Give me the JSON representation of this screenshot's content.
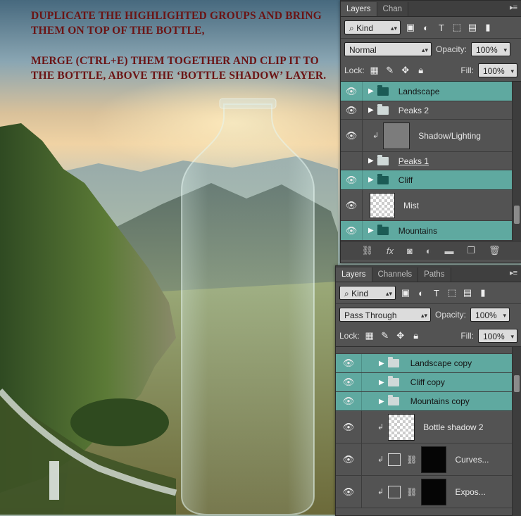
{
  "instructions": {
    "line1": "Duplicate the highlighted groups and bring them on top of the bottle,",
    "line2": "Merge (Ctrl+E) them together and clip it to the bottle, above the ‘bottle shadow’ layer."
  },
  "panel_top": {
    "tabs": [
      "Layers",
      "Chan"
    ],
    "filter": "Kind",
    "blend_mode": "Normal",
    "opacity_label": "Opacity:",
    "opacity": "100%",
    "lock_label": "Lock:",
    "fill_label": "Fill:",
    "fill": "100%",
    "layers": [
      {
        "name": "Landscape",
        "type": "group",
        "selected": true
      },
      {
        "name": "Peaks 2",
        "type": "group",
        "selected": false
      },
      {
        "name": "Shadow/Lighting",
        "type": "clipped",
        "selected": false
      },
      {
        "name": "Peaks 1",
        "type": "group",
        "selected": false
      },
      {
        "name": "Cliff",
        "type": "group",
        "selected": true
      },
      {
        "name": "Mist",
        "type": "layer",
        "selected": false
      },
      {
        "name": "Mountains",
        "type": "group",
        "selected": true
      }
    ]
  },
  "panel_bottom": {
    "tabs": [
      "Layers",
      "Channels",
      "Paths"
    ],
    "filter": "Kind",
    "blend_mode": "Pass Through",
    "opacity_label": "Opacity:",
    "opacity": "100%",
    "lock_label": "Lock:",
    "fill_label": "Fill:",
    "fill": "100%",
    "layers": [
      {
        "name": "Landscape copy",
        "selected": true
      },
      {
        "name": "Cliff copy",
        "selected": true
      },
      {
        "name": "Mountains copy",
        "selected": true
      },
      {
        "name": "Bottle shadow 2",
        "selected": false
      },
      {
        "name": "Curves...",
        "selected": false
      },
      {
        "name": "Expos...",
        "selected": false
      }
    ]
  },
  "footer_icons": [
    "link-icon",
    "fx-icon",
    "mask-icon",
    "adjustment-icon",
    "folder-icon",
    "new-layer-icon",
    "trash-icon"
  ]
}
